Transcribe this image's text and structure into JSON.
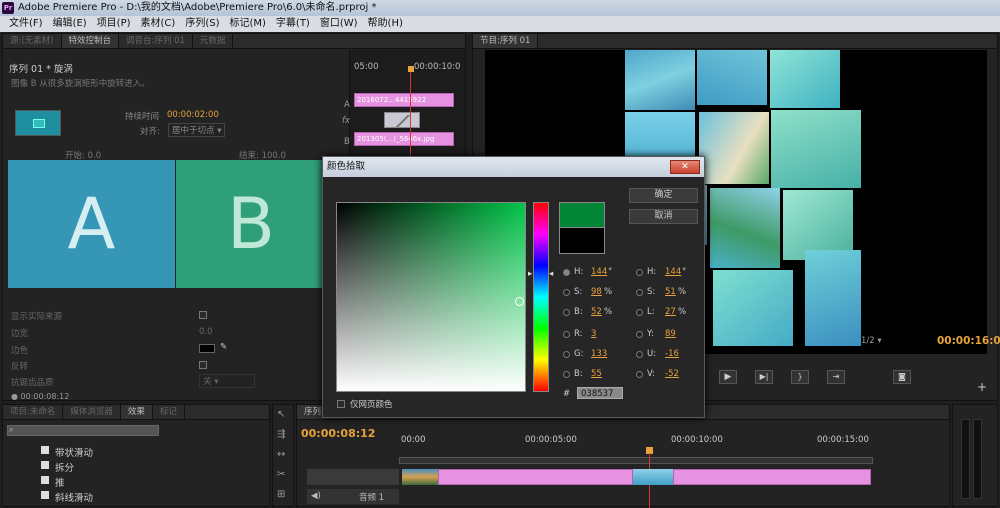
{
  "app": {
    "title": "Adobe Premiere Pro - D:\\我的文档\\Adobe\\Premiere Pro\\6.0\\未命名.prproj *",
    "logo": "Pr"
  },
  "menu": [
    "文件(F)",
    "编辑(E)",
    "项目(P)",
    "素材(C)",
    "序列(S)",
    "标记(M)",
    "字幕(T)",
    "窗口(W)",
    "帮助(H)"
  ],
  "effect_controls": {
    "tabs": [
      "源:(无素材)",
      "特效控制台",
      "调音台:序列 01",
      "元数据"
    ],
    "seq_title": "序列 01 * 旋涡",
    "desc": "图像 B 从很多旋涡矩形中旋转进入。",
    "timeline_start": "05:00",
    "timeline_end": "00:00:10:0",
    "track_a": "A",
    "track_b": "B",
    "clip_a": "2016072...4415922",
    "clip_b": "201305(...)_5646x.jpg",
    "duration_label": "持续时间",
    "duration_value": "00:00:02:00",
    "align_label": "对齐:",
    "align_value": "居中于切点",
    "start_label": "开始:",
    "start_value": "0.0",
    "end_label": "结束:",
    "end_value": "100.0",
    "thumb_a": "A",
    "thumb_b": "B",
    "props": [
      {
        "label": "显示实际来源",
        "value": ""
      },
      {
        "label": "边宽",
        "value": "0.0"
      },
      {
        "label": "边色",
        "value": ""
      },
      {
        "label": "反转",
        "value": ""
      },
      {
        "label": "抗锯齿品质",
        "value": "关"
      }
    ],
    "timecode": "00:00:08:12"
  },
  "program": {
    "tab": "节目:序列 01",
    "zoom": "1/2",
    "timecode": "00:00:16:00"
  },
  "color_picker": {
    "title": "颜色拾取",
    "ok": "确定",
    "cancel": "取消",
    "hsb": [
      {
        "label": "H:",
        "value": "144",
        "unit": "°"
      },
      {
        "label": "S:",
        "value": "98",
        "unit": "%"
      },
      {
        "label": "B:",
        "value": "52",
        "unit": "%"
      }
    ],
    "rgb": [
      {
        "label": "R:",
        "value": "3"
      },
      {
        "label": "G:",
        "value": "133"
      },
      {
        "label": "B:",
        "value": "55"
      }
    ],
    "hsl": [
      {
        "label": "H:",
        "value": "144",
        "unit": "°"
      },
      {
        "label": "S:",
        "value": "51",
        "unit": "%"
      },
      {
        "label": "L:",
        "value": "27",
        "unit": "%"
      }
    ],
    "yuv": [
      {
        "label": "Y:",
        "value": "89"
      },
      {
        "label": "U:",
        "value": "-16"
      },
      {
        "label": "V:",
        "value": "-52"
      }
    ],
    "hash": "#",
    "hex": "038537",
    "web_only": "仅网页颜色",
    "new_color": "#038537",
    "old_color": "#000000",
    "hue_color": "#00ff6a"
  },
  "project": {
    "tabs": [
      "项目:未命名",
      "媒体浏览器",
      "效果",
      "标记"
    ],
    "effects": [
      "带状滑动",
      "拆分",
      "推",
      "斜线滑动"
    ]
  },
  "timeline": {
    "tab": "序列 01",
    "timecode": "00:00:08:12",
    "ticks": [
      "00:00",
      "00:00:05:00",
      "00:00:10:00",
      "00:00:15:00"
    ],
    "audio_track": "音频 1"
  }
}
